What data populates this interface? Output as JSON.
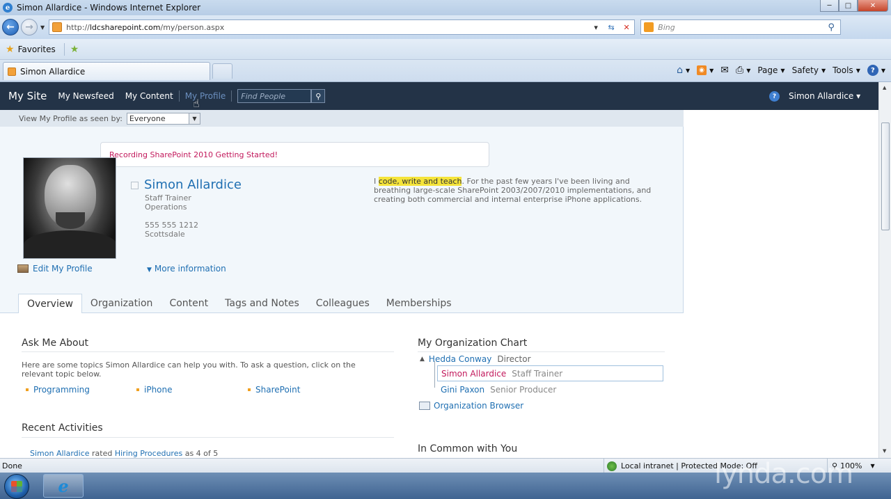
{
  "window": {
    "title": "Simon Allardice - Windows Internet Explorer",
    "minimize": "─",
    "maximize": "□",
    "close": "✕"
  },
  "address": {
    "url_prefix": "http://",
    "url_host": "ldcsharepoint.com",
    "url_path": "/my/person.aspx",
    "search_placeholder": "Bing"
  },
  "favorites": {
    "label": "Favorites"
  },
  "tabs": [
    {
      "title": "Simon Allardice"
    }
  ],
  "commandbar": {
    "page": "Page",
    "safety": "Safety",
    "tools": "Tools"
  },
  "sharepoint": {
    "site_title": "My Site",
    "nav": [
      {
        "label": "My Newsfeed"
      },
      {
        "label": "My Content"
      },
      {
        "label": "My Profile"
      }
    ],
    "find_people_placeholder": "Find People",
    "user": "Simon Allardice ▾"
  },
  "profile": {
    "view_as_label": "View My Profile as seen by:",
    "view_as_value": "Everyone",
    "status_message": "Recording SharePoint 2010 Getting Started!",
    "name": "Simon Allardice",
    "job_title": "Staff Trainer",
    "department": "Operations",
    "phone": "555 555 1212",
    "location": "Scottsdale",
    "about_prefix": "I ",
    "about_highlight": "code, write and teach",
    "about_rest": ". For the past few years I've been living and breathing large-scale SharePoint 2003/2007/2010 implementations, and creating both commercial and internal enterprise iPhone applications.",
    "edit_profile": "Edit My Profile",
    "more_info": "More information",
    "tabs": [
      "Overview",
      "Organization",
      "Content",
      "Tags and Notes",
      "Colleagues",
      "Memberships"
    ]
  },
  "ask_me_about": {
    "heading": "Ask Me About",
    "description": "Here are some topics Simon Allardice can help you with. To ask a question, click on the relevant topic below.",
    "topics": [
      "Programming",
      "iPhone",
      "SharePoint"
    ]
  },
  "recent_activities": {
    "heading": "Recent Activities",
    "item_user": "Simon Allardice",
    "item_text": " rated ",
    "item_target": "Hiring Procedures",
    "item_suffix": " as 4 of 5"
  },
  "org_chart": {
    "heading": "My Organization Chart",
    "manager": {
      "name": "Hedda Conway",
      "title": "Director"
    },
    "me": {
      "name": "Simon Allardice",
      "title": "Staff Trainer"
    },
    "peer": {
      "name": "Gini Paxon",
      "title": "Senior Producer"
    },
    "browser_link": "Organization Browser"
  },
  "in_common": {
    "heading": "In Common with You"
  },
  "statusbar": {
    "status": "Done",
    "zone": "Local intranet | Protected Mode: Off",
    "zoom": "100%"
  },
  "watermark": "lynda.com"
}
